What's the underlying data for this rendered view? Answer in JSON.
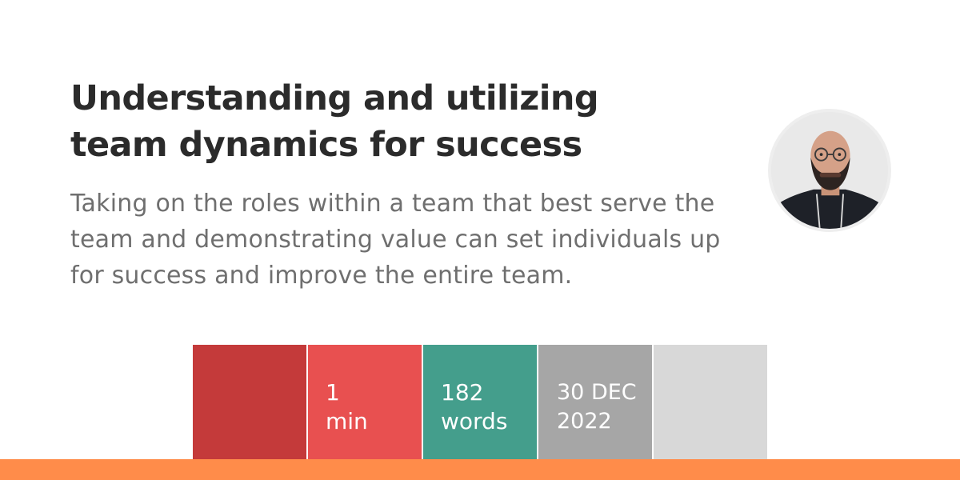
{
  "article": {
    "title": "Understanding and utilizing team dynamics for success",
    "summary": "Taking on the roles within a team that best serve the team and demonstrating value can set individuals up for success and improve the entire team."
  },
  "stats": {
    "reading_time": {
      "value": "1",
      "unit": "min"
    },
    "word_count": {
      "value": "182",
      "unit": "words"
    },
    "date": {
      "day_month": "30 DEC",
      "year": "2022"
    }
  },
  "colors": {
    "block_dark_red": "#c43a3a",
    "block_red": "#e85050",
    "block_teal": "#449e8c",
    "block_gray": "#a6a6a6",
    "block_light_gray": "#d8d8d8",
    "bottom_bar": "#ff8c4a",
    "title_text": "#2b2b2b",
    "summary_text": "#6f6f6f"
  },
  "icons": {
    "author_avatar": "author-photo"
  }
}
